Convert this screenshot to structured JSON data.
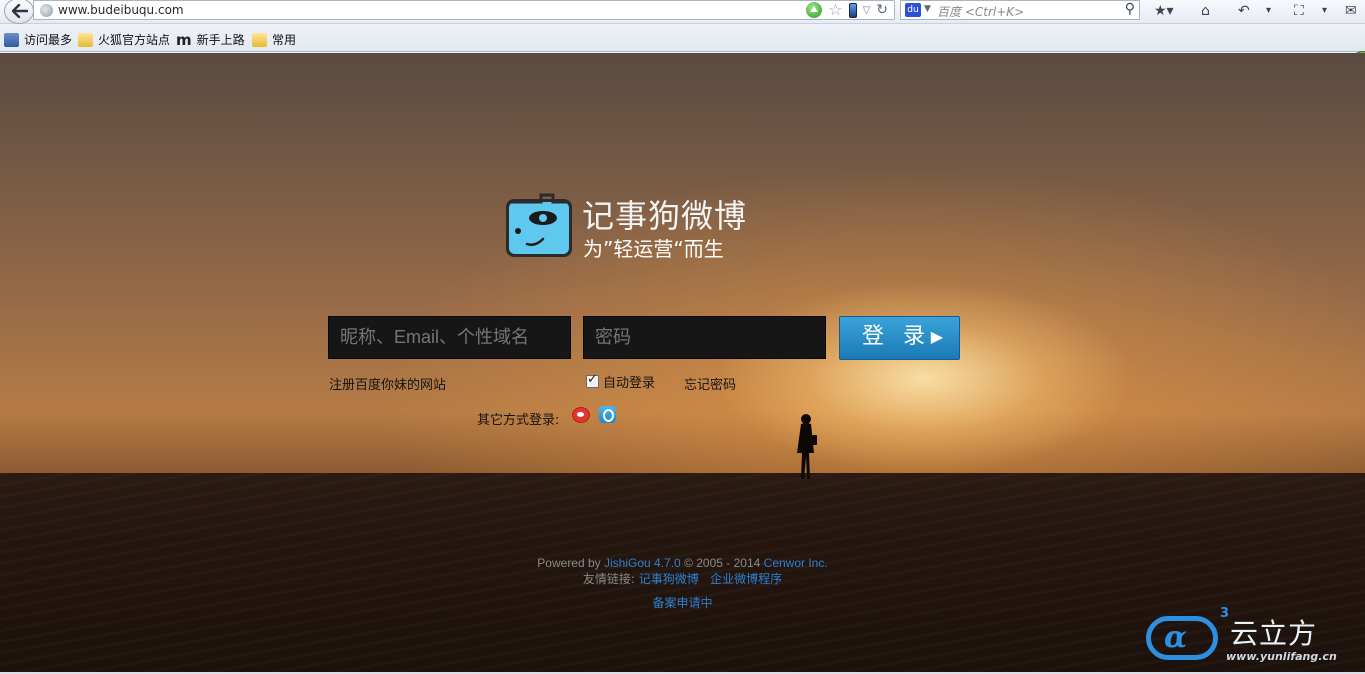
{
  "browser": {
    "url": "www.budeibuqu.com",
    "search_placeholder": "百度 <Ctrl+K>",
    "search_engine_icon": "baidu-paw-icon"
  },
  "bookmarks": [
    {
      "label": "访问最多",
      "icon": "most-visited-icon"
    },
    {
      "label": "火狐官方站点",
      "icon": "folder-icon"
    },
    {
      "label": "新手上路",
      "icon": "m-logo-icon"
    },
    {
      "label": "常用",
      "icon": "folder-icon"
    }
  ],
  "site": {
    "title": "记事狗微博",
    "slogan": "为”轻运营“而生"
  },
  "login": {
    "username_placeholder": "昵称、Email、个性域名",
    "password_placeholder": "密码",
    "submit_label": "登 录",
    "submit_chevron": "▶",
    "register_link": "注册百度你妹的网站",
    "auto_login_label": "自动登录",
    "auto_login_checked": true,
    "forgot_link": "忘记密码",
    "other_methods_label": "其它方式登录:"
  },
  "footer": {
    "powered_by": "Powered by",
    "product": "JishiGou 4.7.0",
    "copyright": "© 2005 - 2014",
    "company": "Cenwor Inc.",
    "friends_label": "友情链接:",
    "friend_links": [
      "记事狗微博",
      "企业微博程序"
    ],
    "icp": "备案申请中"
  },
  "watermark": {
    "name": "云立方",
    "sup": "3",
    "url": "www.yunlifang.cn"
  },
  "colors": {
    "accent": "#2c8fe0",
    "login_button": "#2a8fca",
    "link": "#2e7fd1"
  }
}
